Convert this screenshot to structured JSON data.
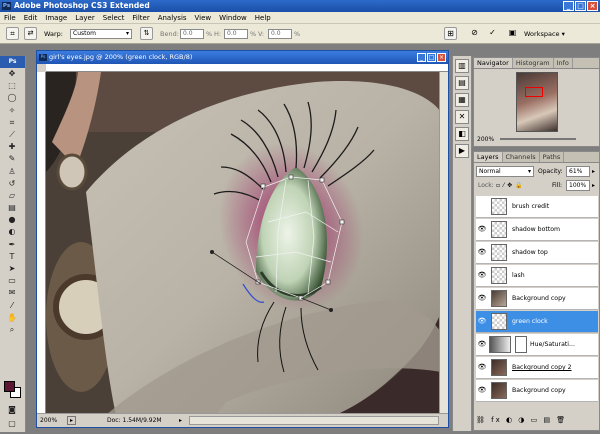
{
  "app": {
    "title": "Adobe Photoshop CS3 Extended",
    "logo": "Ps",
    "logo_small": "Ps",
    "minimize": "_",
    "maximize": "□",
    "close": "×"
  },
  "menu": [
    "File",
    "Edit",
    "Image",
    "Layer",
    "Select",
    "Filter",
    "Analysis",
    "View",
    "Window",
    "Help"
  ],
  "options": {
    "warp_label": "Warp:",
    "warp_value": "Custom",
    "bend_label": "Bend:",
    "bend_value": "0.0",
    "h_label": "H:",
    "h_value": "0.0",
    "v_label": "V:",
    "v_value": "0.0",
    "workspace": "Workspace ▾",
    "percent": "%"
  },
  "document": {
    "title": "girl's eyes.jpg @ 200% (green clock, RGB/8)",
    "zoom": "200%",
    "doc_info": "Doc: 1.54M/9.92M"
  },
  "navigator": {
    "tabs": [
      "Navigator",
      "Histogram",
      "Info"
    ],
    "zoom": "200%"
  },
  "layers": {
    "tabs": [
      "Layers",
      "Channels",
      "Paths"
    ],
    "blend_mode": "Normal",
    "opacity_label": "Opacity:",
    "opacity_value": "61%",
    "lock_label": "Lock:",
    "fill_label": "Fill:",
    "fill_value": "100%",
    "items": [
      {
        "name": "brush credit",
        "selected": false,
        "visible": false
      },
      {
        "name": "shadow bottom",
        "selected": false,
        "visible": true
      },
      {
        "name": "shadow top",
        "selected": false,
        "visible": true
      },
      {
        "name": "lash",
        "selected": false,
        "visible": true
      },
      {
        "name": "Background copy",
        "selected": false,
        "visible": true
      },
      {
        "name": "green clock",
        "selected": true,
        "visible": true
      },
      {
        "name": "Hue/Saturati...",
        "selected": false,
        "visible": true
      },
      {
        "name": "Background copy 2",
        "selected": false,
        "visible": true
      },
      {
        "name": "Background copy",
        "selected": false,
        "visible": true
      }
    ],
    "footer_icons": "⛓ fx ◐ ◑ ▭ ▤ 🗑"
  },
  "colors": {
    "foreground": "#5c1533",
    "background": "#ffffff",
    "selection": "#3d8fe6"
  }
}
